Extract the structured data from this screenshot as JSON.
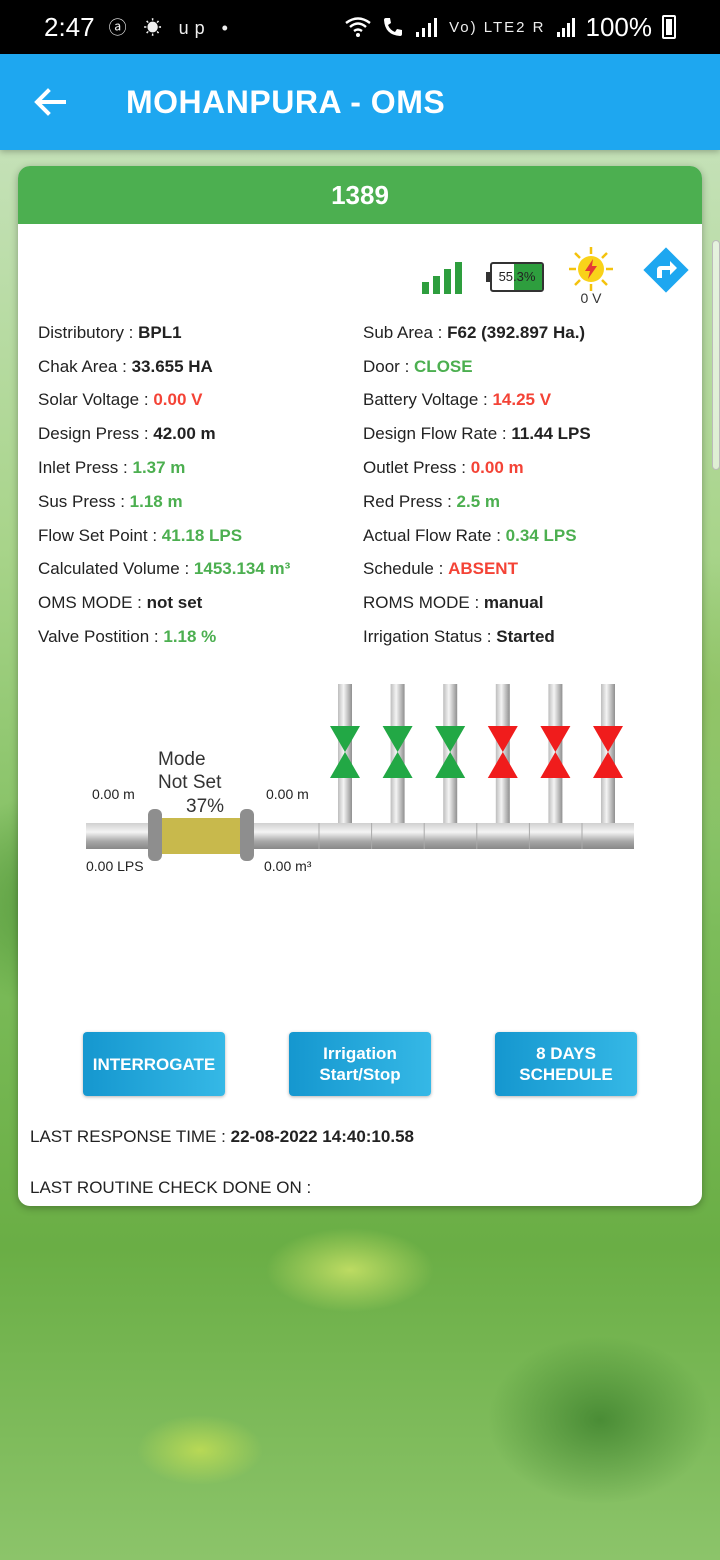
{
  "status_bar": {
    "time": "2:47",
    "notification_icons": "ⓐ ☀ up •",
    "network": "Vo) LTE2 R",
    "battery": "100%"
  },
  "app_bar": {
    "title": "MOHANPURA - OMS"
  },
  "card": {
    "header": "1389",
    "battery_percent_label": "55.3%",
    "battery_level": 0.553,
    "solar_volt": "0 V",
    "rows": [
      {
        "left_label": "Distributory : ",
        "left_value": "BPL1",
        "left_color": "black",
        "right_label": "Sub Area : ",
        "right_value": "F62 (392.897 Ha.)",
        "right_color": "black"
      },
      {
        "left_label": "Chak Area : ",
        "left_value": "33.655 HA",
        "left_color": "black",
        "right_label": "Door : ",
        "right_value": "CLOSE",
        "right_color": "green"
      },
      {
        "left_label": "Solar Voltage : ",
        "left_value": "0.00 V",
        "left_color": "red",
        "right_label": "Battery Voltage : ",
        "right_value": "14.25 V",
        "right_color": "red"
      },
      {
        "left_label": "Design Press : ",
        "left_value": "42.00 m",
        "left_color": "black",
        "right_label": "Design Flow Rate : ",
        "right_value": "11.44 LPS",
        "right_color": "black"
      },
      {
        "left_label": "Inlet Press : ",
        "left_value": "1.37 m",
        "left_color": "green",
        "right_label": "Outlet Press : ",
        "right_value": "0.00 m",
        "right_color": "red"
      },
      {
        "left_label": "Sus Press : ",
        "left_value": "1.18 m",
        "left_color": "green",
        "right_label": "Red Press : ",
        "right_value": "2.5 m",
        "right_color": "green"
      },
      {
        "left_label": "Flow Set Point : ",
        "left_value": "41.18 LPS",
        "left_color": "green",
        "right_label": "Actual Flow Rate : ",
        "right_value": "0.34 LPS",
        "right_color": "green"
      },
      {
        "left_label": "Calculated Volume : ",
        "left_value": "1453.134 m³",
        "left_color": "green",
        "right_label": "Schedule : ",
        "right_value": "ABSENT",
        "right_color": "red"
      },
      {
        "left_label": "OMS MODE : ",
        "left_value": "not set",
        "left_color": "black",
        "right_label": "ROMS MODE : ",
        "right_value": "manual",
        "right_color": "black"
      },
      {
        "left_label": "Valve Postition : ",
        "left_value": "1.18 %",
        "left_color": "green",
        "right_label": "Irrigation Status : ",
        "right_value": "Started",
        "right_color": "black"
      }
    ],
    "diagram": {
      "mode_line1": "Mode",
      "mode_line2": "Not Set",
      "mode_percent": "37%",
      "inlet_press": "0.00 m",
      "inlet_flow": "0.00 LPS",
      "outlet_press": "0.00 m",
      "outlet_volume": "0.00 m³",
      "valve_states": [
        "open",
        "open",
        "open",
        "closed",
        "closed",
        "closed"
      ],
      "open_color": "#22a845",
      "closed_color": "#f01c1c"
    },
    "buttons": {
      "interrogate": "INTERROGATE",
      "irrigation": "Irrigation Start/Stop",
      "schedule": "8 DAYS SCHEDULE"
    },
    "last_response_label": "LAST RESPONSE TIME : ",
    "last_response_value": "22-08-2022  14:40:10.58",
    "last_routine_label": "LAST ROUTINE CHECK DONE ON :"
  }
}
